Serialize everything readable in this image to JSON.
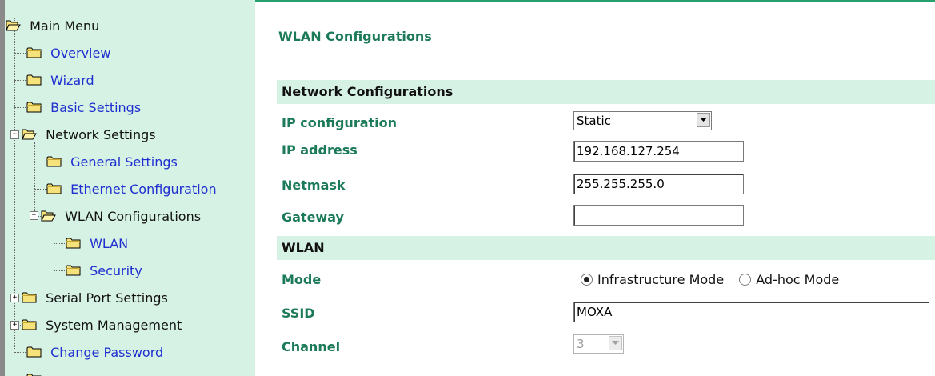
{
  "sidebar": {
    "main_menu": "Main Menu",
    "items": [
      {
        "label": "Overview"
      },
      {
        "label": "Wizard"
      },
      {
        "label": "Basic Settings"
      },
      {
        "label": "Network Settings"
      },
      {
        "label": "General Settings"
      },
      {
        "label": "Ethernet Configuration"
      },
      {
        "label": "WLAN Configurations"
      },
      {
        "label": "WLAN"
      },
      {
        "label": "Security"
      },
      {
        "label": "Serial Port Settings"
      },
      {
        "label": "System Management"
      },
      {
        "label": "Change Password"
      }
    ],
    "expand_symbols": {
      "expanded": "−",
      "collapsed": "+"
    }
  },
  "page": {
    "title": "WLAN Configurations"
  },
  "network_section": {
    "header": "Network Configurations",
    "ip_configuration": {
      "label": "IP configuration",
      "value": "Static"
    },
    "ip_address": {
      "label": "IP address",
      "value": "192.168.127.254"
    },
    "netmask": {
      "label": "Netmask",
      "value": "255.255.255.0"
    },
    "gateway": {
      "label": "Gateway",
      "value": ""
    }
  },
  "wlan_section": {
    "header": "WLAN",
    "mode": {
      "label": "Mode",
      "options": [
        "Infrastructure Mode",
        "Ad-hoc Mode"
      ],
      "selected": "Infrastructure Mode"
    },
    "ssid": {
      "label": "SSID",
      "value": "MOXA"
    },
    "channel": {
      "label": "Channel",
      "value": "3",
      "disabled": true
    }
  },
  "colors": {
    "sidebar_bg": "#d6f2e4",
    "accent_green": "#1b7a57",
    "link_blue": "#1f2fd0"
  },
  "icons": {
    "folder": "folder-icon",
    "open_folder": "open-folder-icon",
    "dropdown": "chevron-down-icon",
    "radio": "radio-icon"
  }
}
